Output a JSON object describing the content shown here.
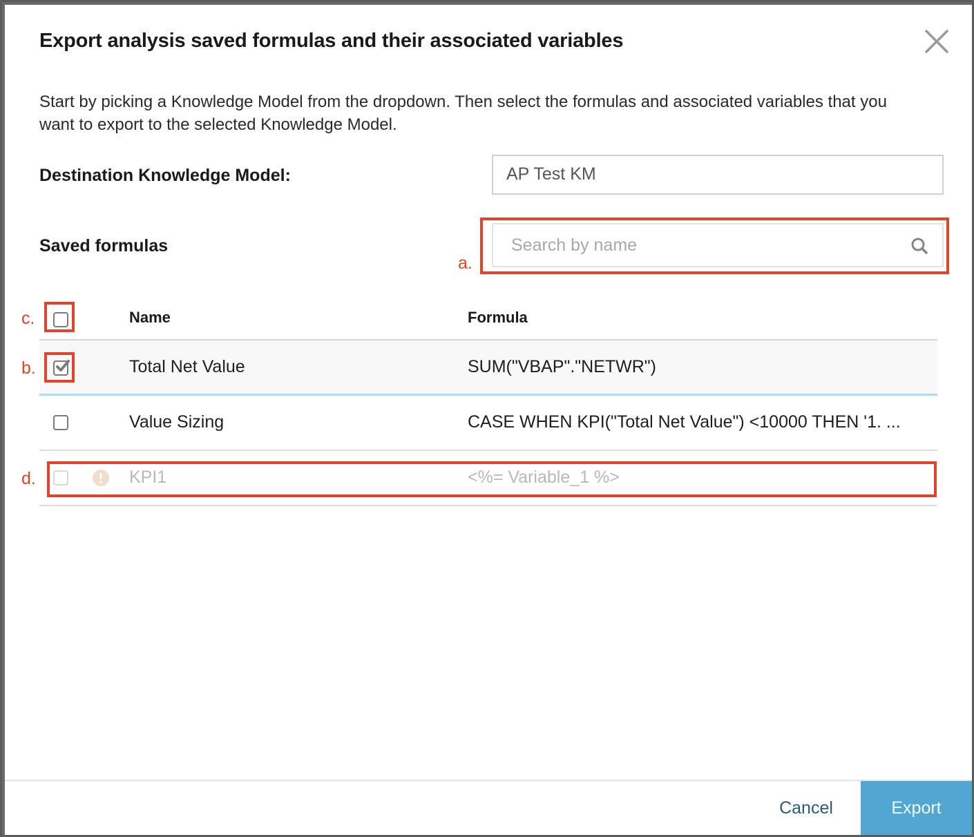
{
  "dialog": {
    "title": "Export analysis saved formulas and their associated variables",
    "description": "Start by picking a Knowledge Model from the dropdown. Then select the formulas and associated variables that you want to export to the selected Knowledge Model.",
    "close_icon": "close-icon"
  },
  "destination": {
    "label": "Destination Knowledge Model:",
    "selected_value": "AP Test KM"
  },
  "saved_formulas": {
    "label": "Saved formulas",
    "search": {
      "value": "",
      "placeholder": "Search by name",
      "icon": "search-icon"
    }
  },
  "table": {
    "columns": [
      "Name",
      "Formula"
    ],
    "select_all_checked": false,
    "rows": [
      {
        "name": "Total Net Value",
        "formula": "SUM(\"VBAP\".\"NETWR\")",
        "checked": true,
        "disabled": false,
        "warning": false
      },
      {
        "name": "Value Sizing",
        "formula": "CASE WHEN KPI(\"Total Net Value\") <10000 THEN '1. ...",
        "checked": false,
        "disabled": false,
        "warning": false
      },
      {
        "name": "KPI1",
        "formula": "<%= Variable_1 %>",
        "checked": false,
        "disabled": true,
        "warning": true
      }
    ]
  },
  "annotations": {
    "a": "a.",
    "b": "b.",
    "c": "c.",
    "d": "d.",
    "color": "#e2432a"
  },
  "footer": {
    "cancel_label": "Cancel",
    "export_label": "Export",
    "export_color": "#52a6d2"
  }
}
